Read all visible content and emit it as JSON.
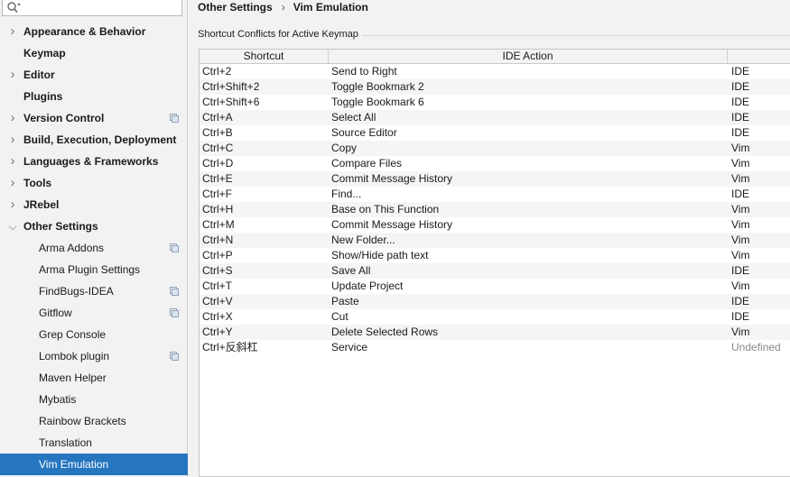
{
  "search": {
    "value": ""
  },
  "sidebar": {
    "items": [
      {
        "label": "Appearance & Behavior",
        "expander": "collapsed"
      },
      {
        "label": "Keymap",
        "expander": "none"
      },
      {
        "label": "Editor",
        "expander": "collapsed"
      },
      {
        "label": "Plugins",
        "expander": "none"
      },
      {
        "label": "Version Control",
        "expander": "collapsed",
        "project_icon": true
      },
      {
        "label": "Build, Execution, Deployment",
        "expander": "collapsed"
      },
      {
        "label": "Languages & Frameworks",
        "expander": "collapsed"
      },
      {
        "label": "Tools",
        "expander": "collapsed"
      },
      {
        "label": "JRebel",
        "expander": "collapsed"
      },
      {
        "label": "Other Settings",
        "expander": "expanded"
      }
    ],
    "children": [
      {
        "label": "Arma Addons",
        "project_icon": true
      },
      {
        "label": "Arma Plugin Settings",
        "project_icon": false
      },
      {
        "label": "FindBugs-IDEA",
        "project_icon": true
      },
      {
        "label": "Gitflow",
        "project_icon": true
      },
      {
        "label": "Grep Console",
        "project_icon": false
      },
      {
        "label": "Lombok plugin",
        "project_icon": true
      },
      {
        "label": "Maven Helper",
        "project_icon": false
      },
      {
        "label": "Mybatis",
        "project_icon": false
      },
      {
        "label": "Rainbow Brackets",
        "project_icon": false
      },
      {
        "label": "Translation",
        "project_icon": false
      },
      {
        "label": "Vim Emulation",
        "project_icon": false,
        "selected": true
      }
    ]
  },
  "breadcrumb": {
    "parent": "Other Settings",
    "separator": "›",
    "current": "Vim Emulation"
  },
  "section": {
    "title": "Shortcut Conflicts for Active Keymap"
  },
  "table": {
    "headers": [
      "Shortcut",
      "IDE Action",
      ""
    ],
    "rows": [
      [
        "Ctrl+2",
        "Send to Right",
        "IDE"
      ],
      [
        "Ctrl+Shift+2",
        "Toggle Bookmark 2",
        "IDE"
      ],
      [
        "Ctrl+Shift+6",
        "Toggle Bookmark 6",
        "IDE"
      ],
      [
        "Ctrl+A",
        "Select All",
        "IDE"
      ],
      [
        "Ctrl+B",
        "Source Editor",
        "IDE"
      ],
      [
        "Ctrl+C",
        "Copy",
        "Vim"
      ],
      [
        "Ctrl+D",
        "Compare Files",
        "Vim"
      ],
      [
        "Ctrl+E",
        "Commit Message History",
        "Vim"
      ],
      [
        "Ctrl+F",
        "Find...",
        "IDE"
      ],
      [
        "Ctrl+H",
        "Base on This Function",
        "Vim"
      ],
      [
        "Ctrl+M",
        "Commit Message History",
        "Vim"
      ],
      [
        "Ctrl+N",
        "New Folder...",
        "Vim"
      ],
      [
        "Ctrl+P",
        "Show/Hide path text",
        "Vim"
      ],
      [
        "Ctrl+S",
        "Save All",
        "IDE"
      ],
      [
        "Ctrl+T",
        "Update Project",
        "Vim"
      ],
      [
        "Ctrl+V",
        "Paste",
        "IDE"
      ],
      [
        "Ctrl+X",
        "Cut",
        "IDE"
      ],
      [
        "Ctrl+Y",
        "Delete Selected Rows",
        "Vim"
      ],
      [
        "Ctrl+反斜杠",
        "Service",
        "Undefined"
      ]
    ]
  },
  "colors": {
    "selection": "#2675bf",
    "undefined_text": "#8a8a8a",
    "background": "#f2f2f2"
  }
}
